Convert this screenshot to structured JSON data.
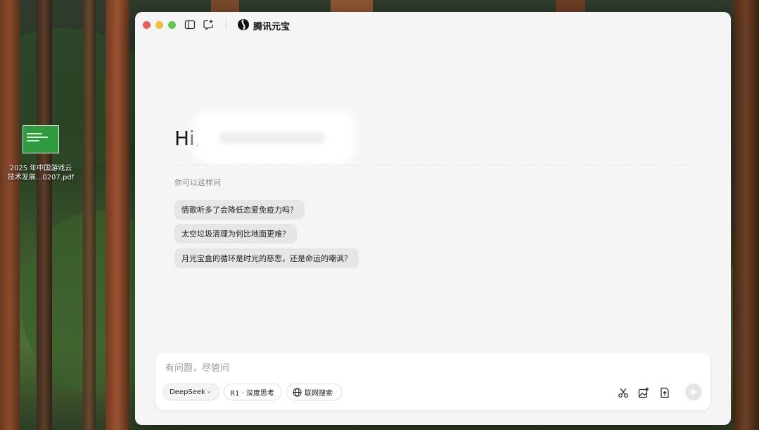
{
  "desktop": {
    "file": {
      "name_line1": "2025 年中国游戏云",
      "name_line2": "技术发展...0207.pdf"
    }
  },
  "app": {
    "title": "腾讯元宝",
    "greeting": "Hi,",
    "suggest_title": "你可以这样问",
    "suggestions": [
      {
        "text": "情歌听多了会降低恋爱免疫力吗？"
      },
      {
        "text": "太空垃圾清理为何比地面更难？"
      },
      {
        "text": "月光宝盒的循环是时光的慈悲，还是命运的嘲讽？"
      }
    ],
    "input": {
      "placeholder": "有问题，尽管问"
    },
    "chips": {
      "model": "DeepSeek",
      "think": "R1 · 深度思考",
      "web": "联网搜索"
    }
  },
  "colors": {
    "accent": "#2fa24a",
    "window_bg": "#f5f5f5",
    "chip_bg": "#e6e6e6"
  },
  "icons": [
    "sidebar-toggle-icon",
    "new-chat-icon",
    "yuanbao-logo-icon",
    "globe-icon",
    "deep-think-icon",
    "scissors-icon",
    "image-add-icon",
    "file-upload-icon",
    "send-icon",
    "chevron-down-icon"
  ]
}
